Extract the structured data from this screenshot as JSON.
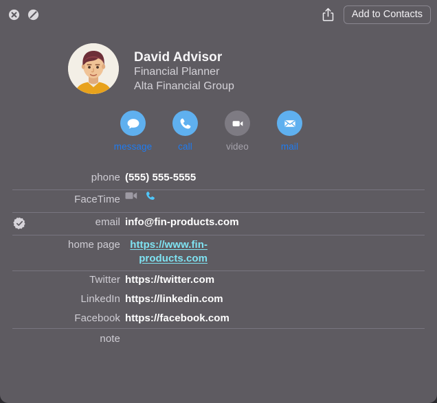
{
  "window": {
    "background_color": "#5e5b61",
    "outer_background_color": "#2b2a2e"
  },
  "toolbar": {
    "close_icon": "close-circle-icon",
    "block_icon": "block-circle-icon",
    "share_icon": "share-icon",
    "add_to_contacts_label": "Add to Contacts"
  },
  "contact": {
    "avatar_icon": "person-avatar",
    "full_name": "David Advisor",
    "job_title": "Financial Planner",
    "organization": "Alta Financial Group"
  },
  "actions": [
    {
      "id": "message",
      "label": "message",
      "icon": "speech-bubble-icon",
      "enabled": true,
      "circle_color": "#5fb0ef",
      "label_color": "#1f7bf0"
    },
    {
      "id": "call",
      "label": "call",
      "icon": "phone-handset-icon",
      "enabled": true,
      "circle_color": "#5fb0ef",
      "label_color": "#1f7bf0"
    },
    {
      "id": "video",
      "label": "video",
      "icon": "video-camera-icon",
      "enabled": false,
      "circle_color": "#7e7b83",
      "label_color": "#a6a3ac"
    },
    {
      "id": "mail",
      "label": "mail",
      "icon": "envelope-icon",
      "enabled": true,
      "circle_color": "#5fb0ef",
      "label_color": "#1f7bf0"
    }
  ],
  "fields": {
    "phone": {
      "label": "phone",
      "value": "(555) 555-5555"
    },
    "facetime": {
      "label": "FaceTime",
      "video_icon": "video-camera-icon",
      "audio_icon": "phone-handset-icon"
    },
    "email": {
      "label": "email",
      "value": "info@fin-products.com",
      "badge_icon": "verified-check-badge-icon"
    },
    "homepage": {
      "label": "home page",
      "value": "https://www.fin-products.com",
      "link_color": "#7fe3f2"
    },
    "twitter": {
      "label": "Twitter",
      "value": "https://twitter.com"
    },
    "linkedin": {
      "label": "LinkedIn",
      "value": "https://linkedin.com"
    },
    "facebook": {
      "label": "Facebook",
      "value": "https://facebook.com"
    },
    "note": {
      "label": "note",
      "value": ""
    }
  }
}
